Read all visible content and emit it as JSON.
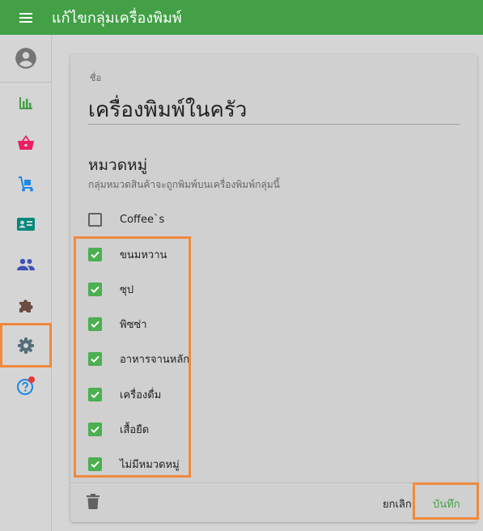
{
  "header": {
    "title": "แก้ไขกลุ่มเครื่องพิมพ์",
    "menu_icon": "menu-icon",
    "bg_color": "#43a047"
  },
  "sidebar": {
    "items": [
      {
        "name": "account",
        "icon": "account-circle-icon",
        "color": "#757575"
      },
      {
        "name": "reports",
        "icon": "bar-chart-icon",
        "color": "#43a047"
      },
      {
        "name": "sales",
        "icon": "basket-icon",
        "color": "#e91e63"
      },
      {
        "name": "inventory",
        "icon": "dolly-icon",
        "color": "#1e88e5"
      },
      {
        "name": "customers",
        "icon": "id-card-icon",
        "color": "#00897b"
      },
      {
        "name": "employees",
        "icon": "people-icon",
        "color": "#3f51b5"
      },
      {
        "name": "apps",
        "icon": "puzzle-icon",
        "color": "#6d4c41"
      },
      {
        "name": "settings",
        "icon": "gear-icon",
        "color": "#546e7a",
        "active": true
      },
      {
        "name": "help",
        "icon": "help-icon",
        "color": "#1e88e5",
        "badge_color": "#e53935"
      }
    ]
  },
  "form": {
    "name_label": "ชื่อ",
    "name_value": "เครื่องพิมพ์ในครัว",
    "categories_title": "หมวดหมู่",
    "categories_subtitle": "กลุ่มหมวดสินค้าจะถูกพิมพ์บนเครื่องพิมพ์กลุ่มนี้",
    "categories": [
      {
        "label": "Coffee`s",
        "checked": false
      },
      {
        "label": "ขนมหวาน",
        "checked": true
      },
      {
        "label": "ซุป",
        "checked": true
      },
      {
        "label": "พิซซ่า",
        "checked": true
      },
      {
        "label": "อาหารจานหลัก",
        "checked": true
      },
      {
        "label": "เครื่องดื่ม",
        "checked": true
      },
      {
        "label": "เสื้อยืด",
        "checked": true
      },
      {
        "label": "ไม่มีหมวดหมู่",
        "checked": true
      }
    ]
  },
  "footer": {
    "delete_icon": "trash-icon",
    "cancel_label": "ยกเลิก",
    "save_label": "บันทึก"
  },
  "colors": {
    "accent": "#43a047",
    "checkbox": "#4caf50",
    "highlight": "#f08a3c"
  }
}
